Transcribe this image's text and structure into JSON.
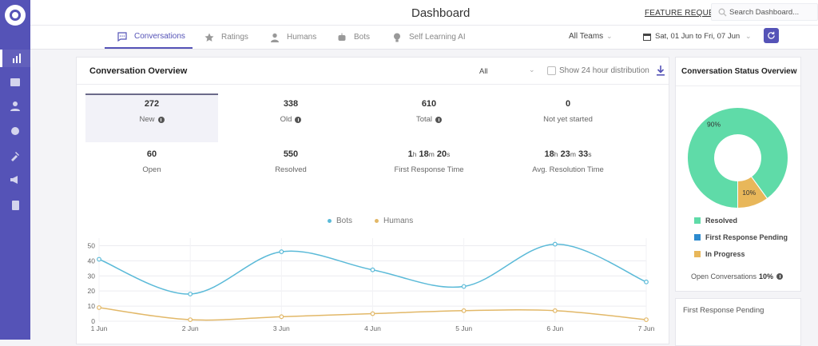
{
  "header": {
    "title": "Dashboard",
    "feature_request": "FEATURE REQUEST",
    "search_placeholder": "Search Dashboard..."
  },
  "sidebar": {
    "items": [
      {
        "icon": "bar-chart-icon",
        "active": true
      },
      {
        "icon": "inbox-icon",
        "active": false
      },
      {
        "icon": "user-icon",
        "active": false
      },
      {
        "icon": "bot-icon",
        "active": false
      },
      {
        "icon": "plug-icon",
        "active": false
      },
      {
        "icon": "megaphone-icon",
        "active": false
      },
      {
        "icon": "document-icon",
        "active": false
      }
    ]
  },
  "tabs": [
    {
      "label": "Conversations",
      "icon": "chat-icon",
      "active": true
    },
    {
      "label": "Ratings",
      "icon": "star-icon",
      "active": false
    },
    {
      "label": "Humans",
      "icon": "person-icon",
      "active": false
    },
    {
      "label": "Bots",
      "icon": "bot-icon",
      "active": false
    },
    {
      "label": "Self Learning AI",
      "icon": "bulb-icon",
      "active": false
    }
  ],
  "filters": {
    "team": "All Teams",
    "date_range": "Sat, 01 Jun to Fri, 07 Jun"
  },
  "overview": {
    "title": "Conversation Overview",
    "filter_value": "All",
    "distribution_label": "Show 24 hour distribution",
    "stats": [
      {
        "value": "272",
        "label": "New",
        "info": true
      },
      {
        "value": "338",
        "label": "Old",
        "info": true
      },
      {
        "value": "610",
        "label": "Total",
        "info": true
      },
      {
        "value": "0",
        "label": "Not yet started",
        "info": false
      },
      {
        "value": "60",
        "label": "Open",
        "info": false
      },
      {
        "value": "550",
        "label": "Resolved",
        "info": false
      },
      {
        "label": "First Response Time",
        "h": "1",
        "m": "18",
        "s": "20"
      },
      {
        "label": "Avg. Resolution Time",
        "h": "18",
        "m": "23",
        "s": "33"
      }
    ],
    "units": {
      "h": "h",
      "m": "m",
      "s": "s"
    }
  },
  "chart_data": {
    "type": "line",
    "categories": [
      "1 Jun",
      "2 Jun",
      "3 Jun",
      "4 Jun",
      "5 Jun",
      "6 Jun",
      "7 Jun"
    ],
    "series": [
      {
        "name": "Bots",
        "values": [
          41,
          18,
          46,
          34,
          23,
          51,
          26
        ],
        "color": "#5bbad8"
      },
      {
        "name": "Humans",
        "values": [
          9,
          1,
          3,
          5,
          7,
          7,
          1
        ],
        "color": "#e2b868"
      }
    ],
    "ylim": [
      0,
      55
    ],
    "yticks": [
      0,
      10,
      20,
      30,
      40,
      50
    ],
    "grid": true,
    "legend": "top-center"
  },
  "status_overview": {
    "title": "Conversation Status Overview",
    "slices": [
      {
        "label": "Resolved",
        "value": 90,
        "display": "90%",
        "color": "#5fdba8"
      },
      {
        "label": "First Response Pending",
        "value": 0,
        "display": "",
        "color": "#2d8bcf"
      },
      {
        "label": "In Progress",
        "value": 10,
        "display": "10%",
        "color": "#e8b75a"
      }
    ],
    "open_label": "Open Conversations",
    "open_value": "10%"
  },
  "pending_card": {
    "title": "First Response Pending"
  }
}
